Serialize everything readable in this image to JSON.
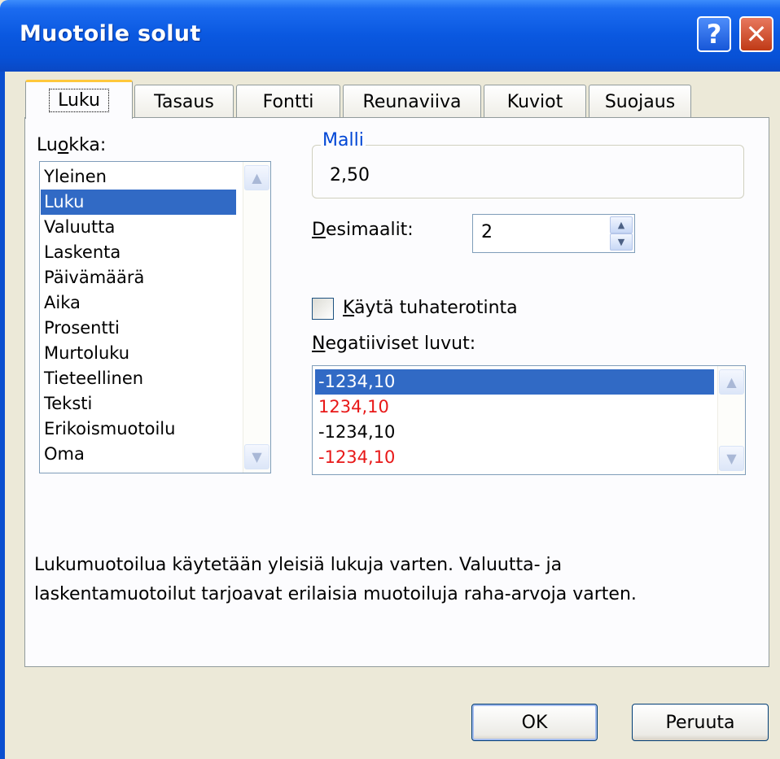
{
  "window": {
    "title": "Muotoile solut"
  },
  "titlebar_buttons": {
    "help": "?",
    "close": "✕"
  },
  "tabs": [
    {
      "label": "Luku",
      "active": true
    },
    {
      "label": "Tasaus",
      "active": false
    },
    {
      "label": "Fontti",
      "active": false
    },
    {
      "label": "Reunaviiva",
      "active": false
    },
    {
      "label": "Kuviot",
      "active": false
    },
    {
      "label": "Suojaus",
      "active": false
    }
  ],
  "category": {
    "label_pre": "Lu",
    "label_key": "o",
    "label_post": "kka:",
    "items": [
      "Yleinen",
      "Luku",
      "Valuutta",
      "Laskenta",
      "Päivämäärä",
      "Aika",
      "Prosentti",
      "Murtoluku",
      "Tieteellinen",
      "Teksti",
      "Erikoismuotoilu",
      "Oma"
    ],
    "selected": "Luku"
  },
  "sample": {
    "label": "Malli",
    "value": "2,50"
  },
  "decimals": {
    "label_key": "D",
    "label_post": "esimaalit:",
    "value": "2"
  },
  "thousands": {
    "label_key": "K",
    "label_post": "äytä tuhaterotinta",
    "checked": false
  },
  "negative": {
    "label_key": "N",
    "label_post": "egatiiviset luvut:",
    "items": [
      {
        "text": "-1234,10",
        "color": "#ffffff",
        "selected": true
      },
      {
        "text": "1234,10",
        "color": "#e81818",
        "selected": false
      },
      {
        "text": "-1234,10",
        "color": "#000000",
        "selected": false
      },
      {
        "text": "-1234,10",
        "color": "#e81818",
        "selected": false
      }
    ]
  },
  "description": {
    "line1": "Lukumuotoilua käytetään yleisiä lukuja varten. Valuutta- ja",
    "line2": "laskentamuotoilut tarjoavat erilaisia muotoiluja raha-arvoja varten."
  },
  "buttons": {
    "ok": "OK",
    "cancel": "Peruuta"
  },
  "colors": {
    "selection": "#316ac5",
    "negative_red": "#e81818",
    "title_blue": "#0a58e0"
  }
}
